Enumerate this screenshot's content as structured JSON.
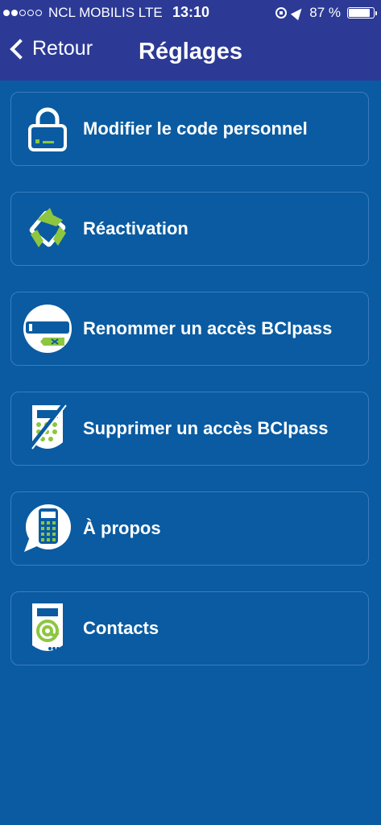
{
  "status_bar": {
    "carrier": "NCL MOBILIS  LTE",
    "time": "13:10",
    "battery": "87 %",
    "battery_level": 0.87
  },
  "nav": {
    "back_label": "Retour",
    "title": "Réglages"
  },
  "menu": [
    {
      "label": "Modifier le code personnel",
      "icon": "padlock-icon"
    },
    {
      "label": "Réactivation",
      "icon": "refresh-icon"
    },
    {
      "label": "Renommer un accès BCIpass",
      "icon": "rename-icon"
    },
    {
      "label": "Supprimer un accès BCIpass",
      "icon": "delete-device-icon"
    },
    {
      "label": "À propos",
      "icon": "info-device-icon"
    },
    {
      "label": "Contacts",
      "icon": "contact-icon"
    }
  ],
  "colors": {
    "background": "#0a5ba1",
    "header": "#2c3a96",
    "accent_green": "#8dc63f",
    "item_border": "#3b7cc0"
  }
}
